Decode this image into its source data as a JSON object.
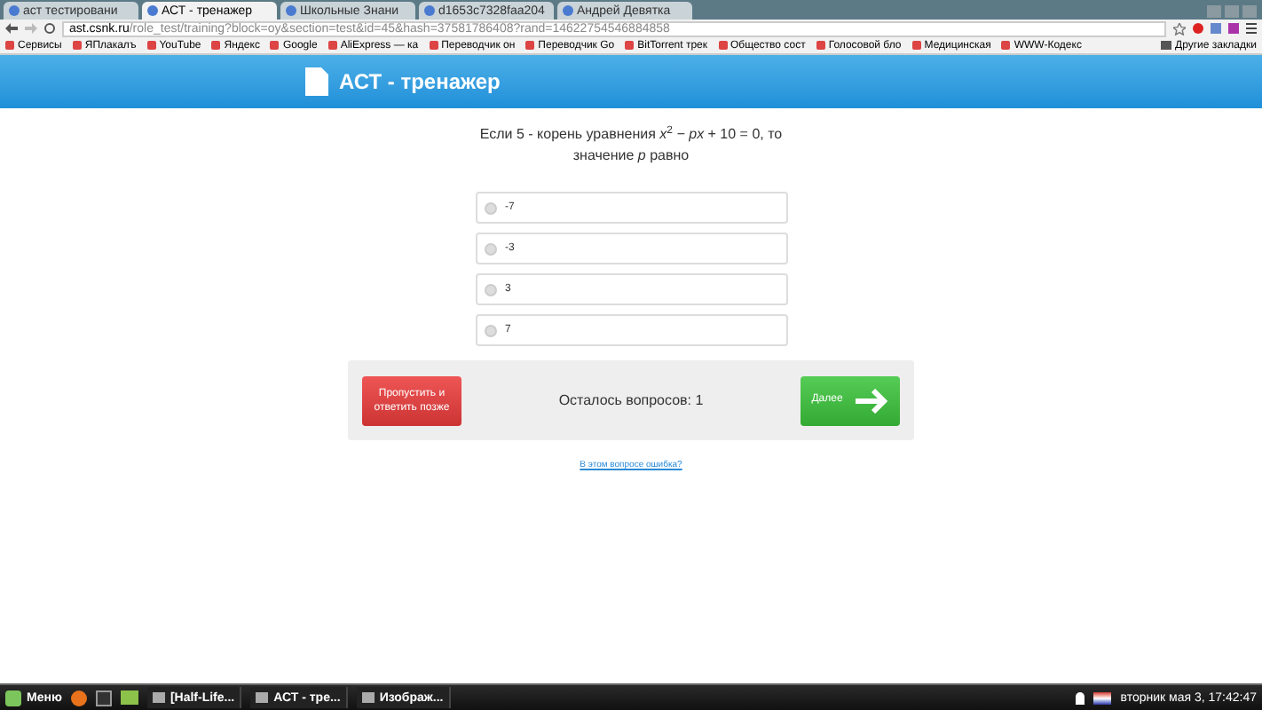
{
  "browser": {
    "tabs": [
      {
        "label": "аст тестировани",
        "selected": false
      },
      {
        "label": "АСТ - тренажер",
        "selected": true
      },
      {
        "label": "Школьные Знани",
        "selected": false
      },
      {
        "label": "d1653c7328faa204",
        "selected": false
      },
      {
        "label": "Андрей Девятка",
        "selected": false
      }
    ],
    "address": {
      "host": "ast.csnk.ru",
      "path": "/role_test/training?block=oy&section=test&id=45&hash=37581786408?rand=14622754546884858"
    },
    "bookmarks": [
      "Сервисы",
      "ЯПлакалъ",
      "YouTube",
      "Яндекс",
      "Google",
      "AliExpress — ка",
      "Переводчик он",
      "Переводчик Go",
      "BitTorrent трек",
      "Общество сост",
      "Голосовой бло",
      "Медицинская",
      "WWW-Кодекс"
    ],
    "other_bookmarks": "Другие закладки"
  },
  "header": {
    "title": "АСТ - тренажер"
  },
  "question": "Если 5 - корень уравнения *x*$^{2}$ *− px* + 10 = 0, то значение *p* равно",
  "options": [
    {
      "label": "-7",
      "selected": false
    },
    {
      "label": "-3",
      "selected": false
    },
    {
      "label": "3",
      "selected": false
    },
    {
      "label": "7",
      "selected": false
    }
  ],
  "skip_button": "Пропустить и ответить позже",
  "remaining": "Осталось вопросов: 1",
  "next_button": "Далее",
  "error_link": "В этом вопросе ошибка?",
  "taskbar": {
    "menu": "Меню",
    "windows": [
      "[Half-Life...",
      "АСТ - тре...",
      "Изображ..."
    ],
    "clock": "вторник мая 3, 17:42:47"
  }
}
